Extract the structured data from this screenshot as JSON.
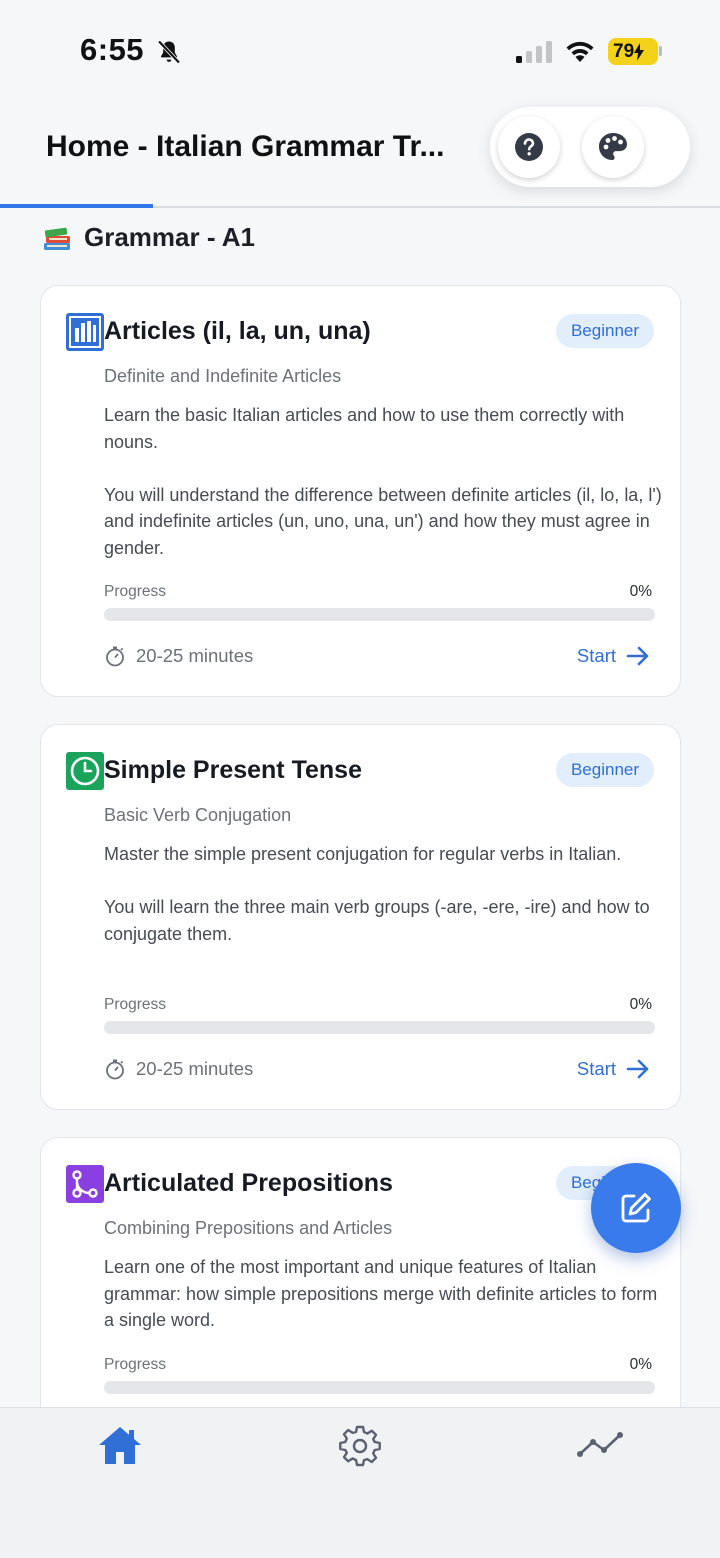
{
  "status_bar": {
    "time": "6:55",
    "battery": "79"
  },
  "header": {
    "title": "Home - Italian Grammar Tr...",
    "help_icon": "question-circle-icon",
    "theme_icon": "palette-icon",
    "accent_color": "#3477ea"
  },
  "section": {
    "icon": "books-emoji-icon",
    "title": "Grammar - A1"
  },
  "lessons": [
    {
      "icon": "bar-chart-icon",
      "title": "Articles (il, la, un, una)",
      "level": "Beginner",
      "subtitle": "Definite and Indefinite Articles",
      "description_1": "Learn the basic Italian articles and how to use them correctly with nouns.",
      "description_2": "You will understand the difference between definite articles (il, lo, la, l') and indefinite articles (un, uno, una, un') and how they must agree in gender.",
      "progress_label": "Progress",
      "progress_value": "0%",
      "progress": 0,
      "duration": "20-25 minutes",
      "start_label": "Start"
    },
    {
      "icon": "clock-icon",
      "title": "Simple Present Tense",
      "level": "Beginner",
      "subtitle": "Basic Verb Conjugation",
      "description_1": "Master the simple present conjugation for regular verbs in Italian.",
      "description_2": "You will learn the three main verb groups (-are, -ere, -ire) and how to conjugate them.",
      "progress_label": "Progress",
      "progress_value": "0%",
      "progress": 0,
      "duration": "20-25 minutes",
      "start_label": "Start"
    },
    {
      "icon": "branch-icon",
      "title": "Articulated Prepositions",
      "level": "Beginner",
      "subtitle": "Combining Prepositions and Articles",
      "description_1": "Learn one of the most important and unique features of Italian grammar: how simple prepositions merge with definite articles to form a single word.",
      "progress_label": "Progress",
      "progress_value": "0%",
      "progress": 0
    }
  ],
  "fab": {
    "icon": "edit-note-icon"
  },
  "bottom_nav": [
    {
      "icon": "home-icon",
      "active": true
    },
    {
      "icon": "settings-gear-icon",
      "active": false
    },
    {
      "icon": "trend-line-icon",
      "active": false
    }
  ]
}
